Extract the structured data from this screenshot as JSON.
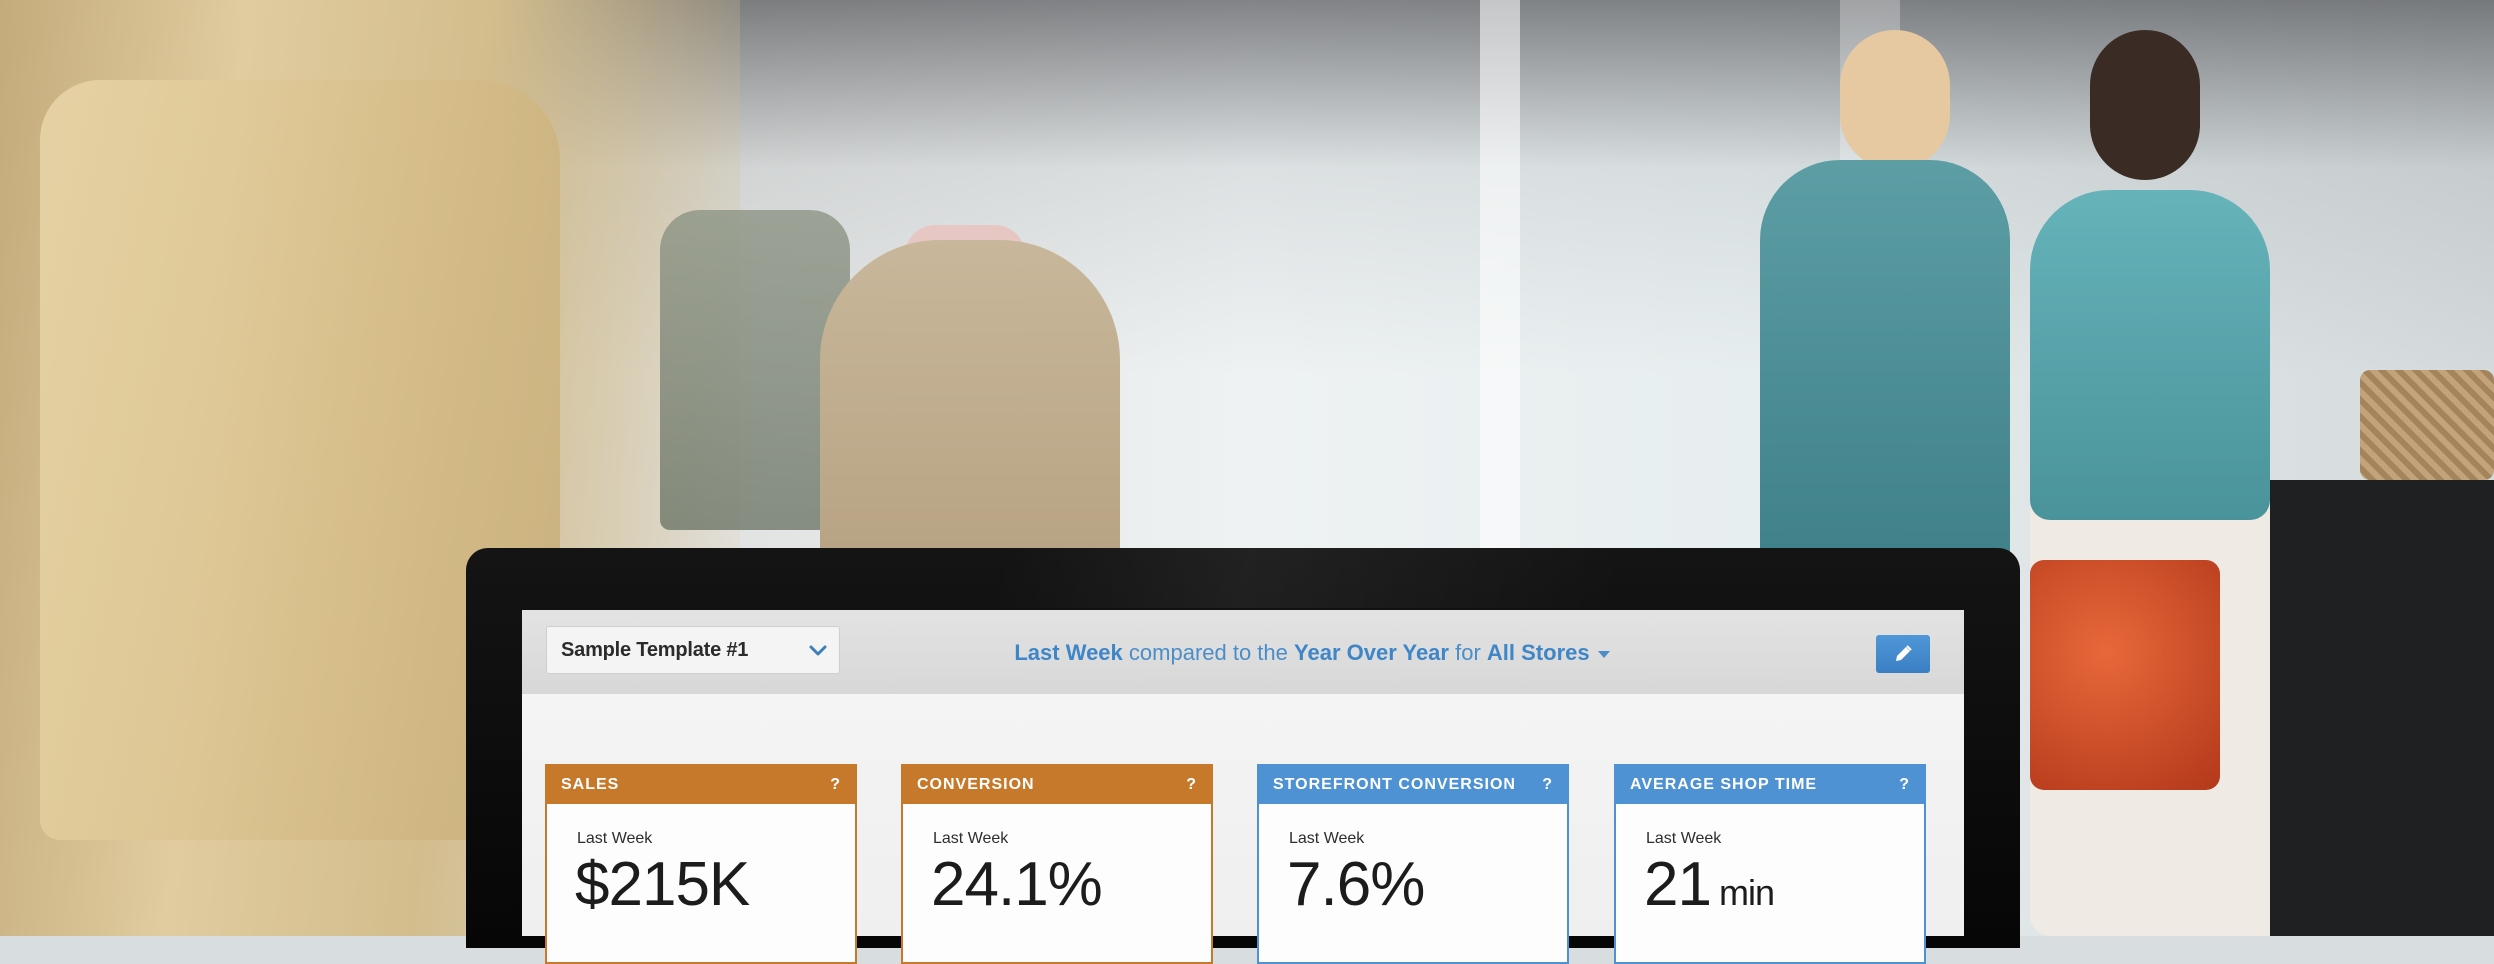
{
  "toolbar": {
    "template_select": {
      "label": "Sample Template #1",
      "icon": "chevron-down-icon"
    },
    "period": {
      "range": "Last Week",
      "text1": "compared to the",
      "comparison": "Year Over Year",
      "text2": "for",
      "scope": "All Stores"
    },
    "edit_button": {
      "icon": "pencil-icon"
    }
  },
  "cards": [
    {
      "title": "SALES",
      "help": "?",
      "period": "Last Week",
      "value": "$215K",
      "unit": "",
      "color": "#c7792b"
    },
    {
      "title": "CONVERSION",
      "help": "?",
      "period": "Last Week",
      "value": "24.1%",
      "unit": "",
      "color": "#c7792b"
    },
    {
      "title": "STOREFRONT CONVERSION",
      "help": "?",
      "period": "Last Week",
      "value": "7.6%",
      "unit": "",
      "color": "#4f92d4"
    },
    {
      "title": "AVERAGE SHOP TIME",
      "help": "?",
      "period": "Last Week",
      "value": "21",
      "unit": "min",
      "color": "#4f92d4"
    }
  ],
  "colors": {
    "accent_blue": "#4f92d4",
    "accent_orange": "#c7792b",
    "bezel": "#0b0b0b"
  }
}
